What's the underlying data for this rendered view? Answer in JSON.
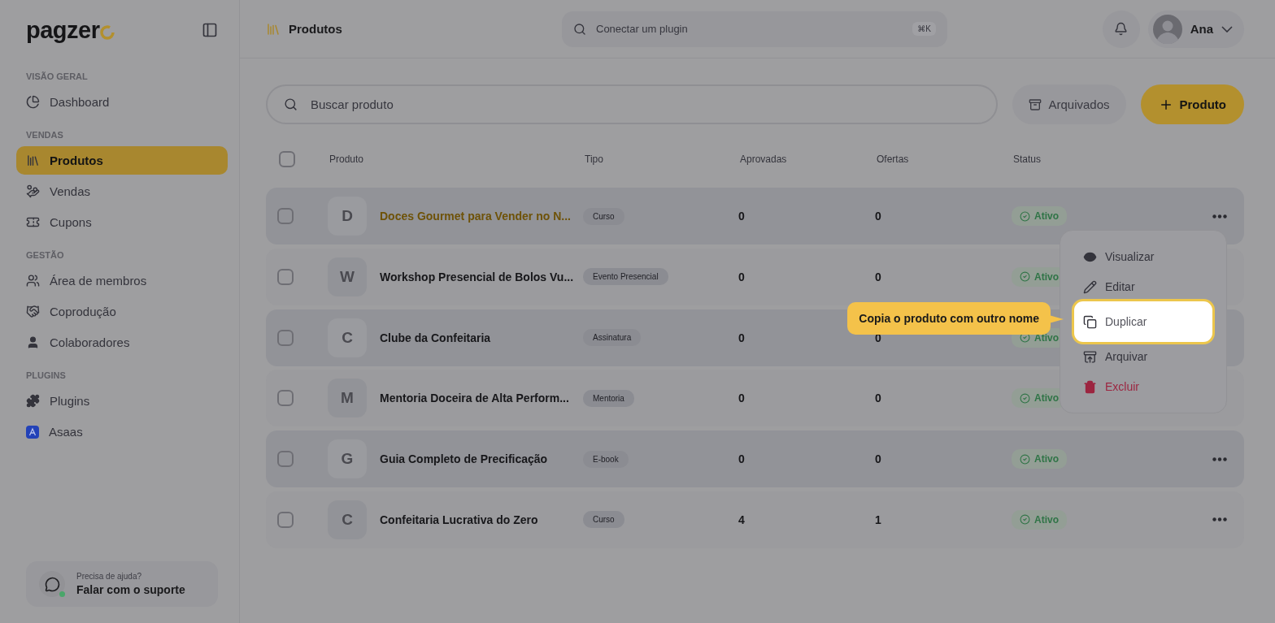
{
  "sidebar": {
    "logo": "pagzer",
    "sections": [
      {
        "label": "VISÃO GERAL",
        "items": [
          {
            "label": "Dashboard",
            "selected": false
          }
        ]
      },
      {
        "label": "VENDAS",
        "items": [
          {
            "label": "Produtos",
            "selected": true
          },
          {
            "label": "Vendas",
            "selected": false
          },
          {
            "label": "Cupons",
            "selected": false
          }
        ]
      },
      {
        "label": "GESTÃO",
        "items": [
          {
            "label": "Área de membros",
            "selected": false
          },
          {
            "label": "Coprodução",
            "selected": false
          },
          {
            "label": "Colaboradores",
            "selected": false
          }
        ]
      },
      {
        "label": "PLUGINS",
        "items": [
          {
            "label": "Plugins",
            "selected": false
          },
          {
            "label": "Asaas",
            "selected": false
          }
        ]
      }
    ],
    "help": {
      "caption": "Precisa de ajuda?",
      "title": "Falar com o suporte",
      "online": true
    }
  },
  "header": {
    "breadcrumb": "Produtos",
    "search": {
      "placeholder": "Conectar um plugin",
      "shortcut": "⌘K"
    },
    "user": {
      "name": "Ana"
    }
  },
  "toolbar": {
    "search": {
      "placeholder": "Buscar produto"
    },
    "archived_button": "Arquivados",
    "new_button": "Produto"
  },
  "table": {
    "select_all_checked": false,
    "columns": [
      "Produto",
      "Tipo",
      "Aprovadas",
      "Ofertas",
      "Status"
    ],
    "rows": [
      {
        "checked": false,
        "initial": "D",
        "name": "Doces Gourmet para Vender no N...",
        "type": "Curso",
        "approved": "0",
        "offers": "0",
        "status": "Ativo",
        "hovered": true,
        "show_menu_button": true
      },
      {
        "checked": false,
        "initial": "W",
        "name": "Workshop Presencial de Bolos Vu...",
        "type": "Evento Presencial",
        "approved": "0",
        "offers": "0",
        "status": "Ativo",
        "hovered": false,
        "show_menu_button": false
      },
      {
        "checked": false,
        "initial": "C",
        "name": "Clube da Confeitaria",
        "type": "Assinatura",
        "approved": "0",
        "offers": "0",
        "status": "Ativo",
        "hovered": false,
        "show_menu_button": false
      },
      {
        "checked": false,
        "initial": "M",
        "name": "Mentoria Doceira de Alta Perform...",
        "type": "Mentoria",
        "approved": "0",
        "offers": "0",
        "status": "Ativo",
        "hovered": false,
        "show_menu_button": false
      },
      {
        "checked": false,
        "initial": "G",
        "name": "Guia Completo de Precificação",
        "type": "E-book",
        "approved": "0",
        "offers": "0",
        "status": "Ativo",
        "hovered": false,
        "show_menu_button": true
      },
      {
        "checked": false,
        "initial": "C",
        "name": "Confeitaria Lucrativa do Zero",
        "type": "Curso",
        "approved": "4",
        "offers": "1",
        "status": "Ativo",
        "hovered": false,
        "show_menu_button": true
      }
    ]
  },
  "row_menu": {
    "items": [
      {
        "label": "Visualizar",
        "kind": "normal",
        "highlighted": false
      },
      {
        "label": "Editar",
        "kind": "normal",
        "highlighted": false
      },
      {
        "label": "Duplicar",
        "kind": "normal",
        "highlighted": true
      },
      {
        "label": "Arquivar",
        "kind": "normal",
        "highlighted": false
      },
      {
        "label": "Excluir",
        "kind": "danger",
        "highlighted": false
      }
    ]
  },
  "tooltip": "Copia o produto com outro nome"
}
